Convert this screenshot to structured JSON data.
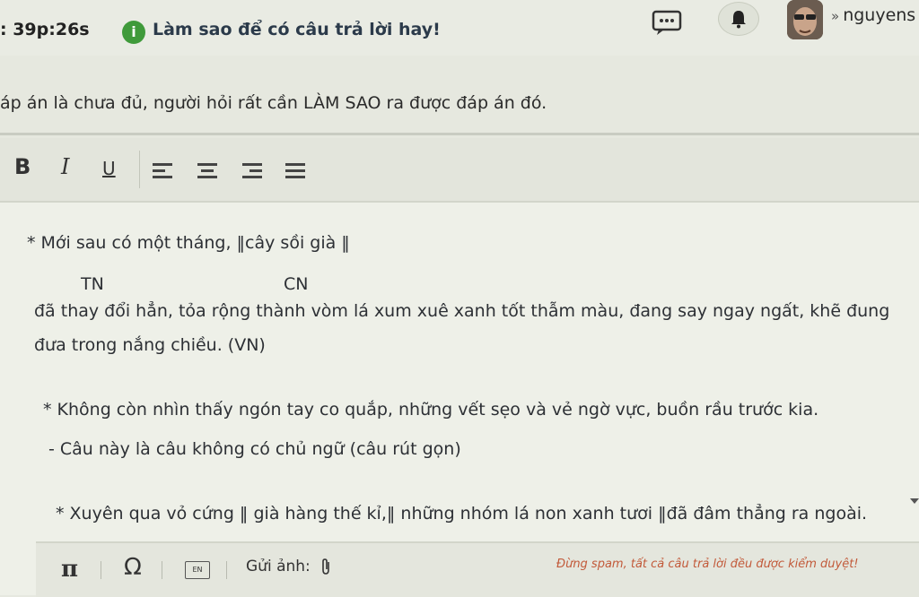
{
  "header": {
    "timer": ": 39p:26s",
    "hint_icon": "i",
    "hint_text": "Làm sao để có câu trả lời hay!",
    "username": "nguyens",
    "chevron": "»"
  },
  "question_note": "áp án là chưa đủ, người hỏi rất cần LÀM SAO ra được đáp án đó.",
  "toolbar": {
    "bold": "B",
    "italic": "I",
    "underline": "U"
  },
  "answer_lines": [
    "* Mới sau có một tháng, ‖cây sồi già ‖",
    "TN",
    "CN",
    "đã thay đổi hẳn, tỏa rộng thành vòm lá xum xuê xanh tốt  thẫm màu, đang say ngay ngất, khẽ đung",
    "đưa trong nắng chiều. (VN)",
    "* Không còn nhìn thấy ngón tay co quắp, những vết sẹo và vẻ ngờ vực, buồn rầu trước kia.",
    "- Câu này là câu không có chủ ngữ (câu rút gọn)",
    "* Xuyên qua vỏ cứng ‖ già hàng thế kỉ,‖ những nhóm lá non xanh tươi ‖đã đâm thẳng ra ngoài."
  ],
  "footer": {
    "pi": "π",
    "omega": "Ω",
    "keyboard": "EN",
    "upload_label": "Gửi ảnh:",
    "note": "Đừng spam, tất cả câu trả lời đều được kiểm duyệt!"
  },
  "colors": {
    "hint_green": "#3f9a3a",
    "note_orange": "#c25a3a"
  },
  "icons": [
    "info-icon",
    "chat-icon",
    "bell-icon",
    "avatar",
    "chevron-icon",
    "pi-icon",
    "omega-icon",
    "keyboard-icon",
    "paperclip-icon",
    "align-left-icon",
    "align-center-icon",
    "align-right-icon",
    "align-justify-icon"
  ]
}
